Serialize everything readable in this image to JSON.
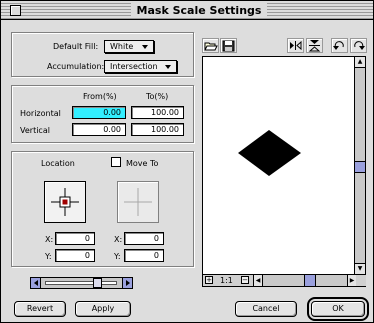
{
  "window": {
    "title": "Mask Scale Settings"
  },
  "settings": {
    "default_fill_label": "Default Fill:",
    "default_fill_value": "White",
    "accumulation_label": "Accumulation:",
    "accumulation_value": "Intersection"
  },
  "scale": {
    "from_header": "From(%)",
    "to_header": "To(%)",
    "horizontal_label": "Horizontal",
    "vertical_label": "Vertical",
    "horizontal_from": "0.00",
    "horizontal_to": "100.00",
    "vertical_from": "0.00",
    "vertical_to": "100.00"
  },
  "location": {
    "location_label": "Location",
    "move_to_label": "Move To",
    "x_label": "X:",
    "y_label": "Y:",
    "loc_x": "0",
    "loc_y": "0",
    "move_x": "0",
    "move_y": "0"
  },
  "preview": {
    "zoom": "1:1",
    "shape_color": "#000000"
  },
  "buttons": {
    "revert": "Revert",
    "apply": "Apply",
    "cancel": "Cancel",
    "ok": "OK"
  },
  "colors": {
    "highlight_field": "#33eeff"
  }
}
